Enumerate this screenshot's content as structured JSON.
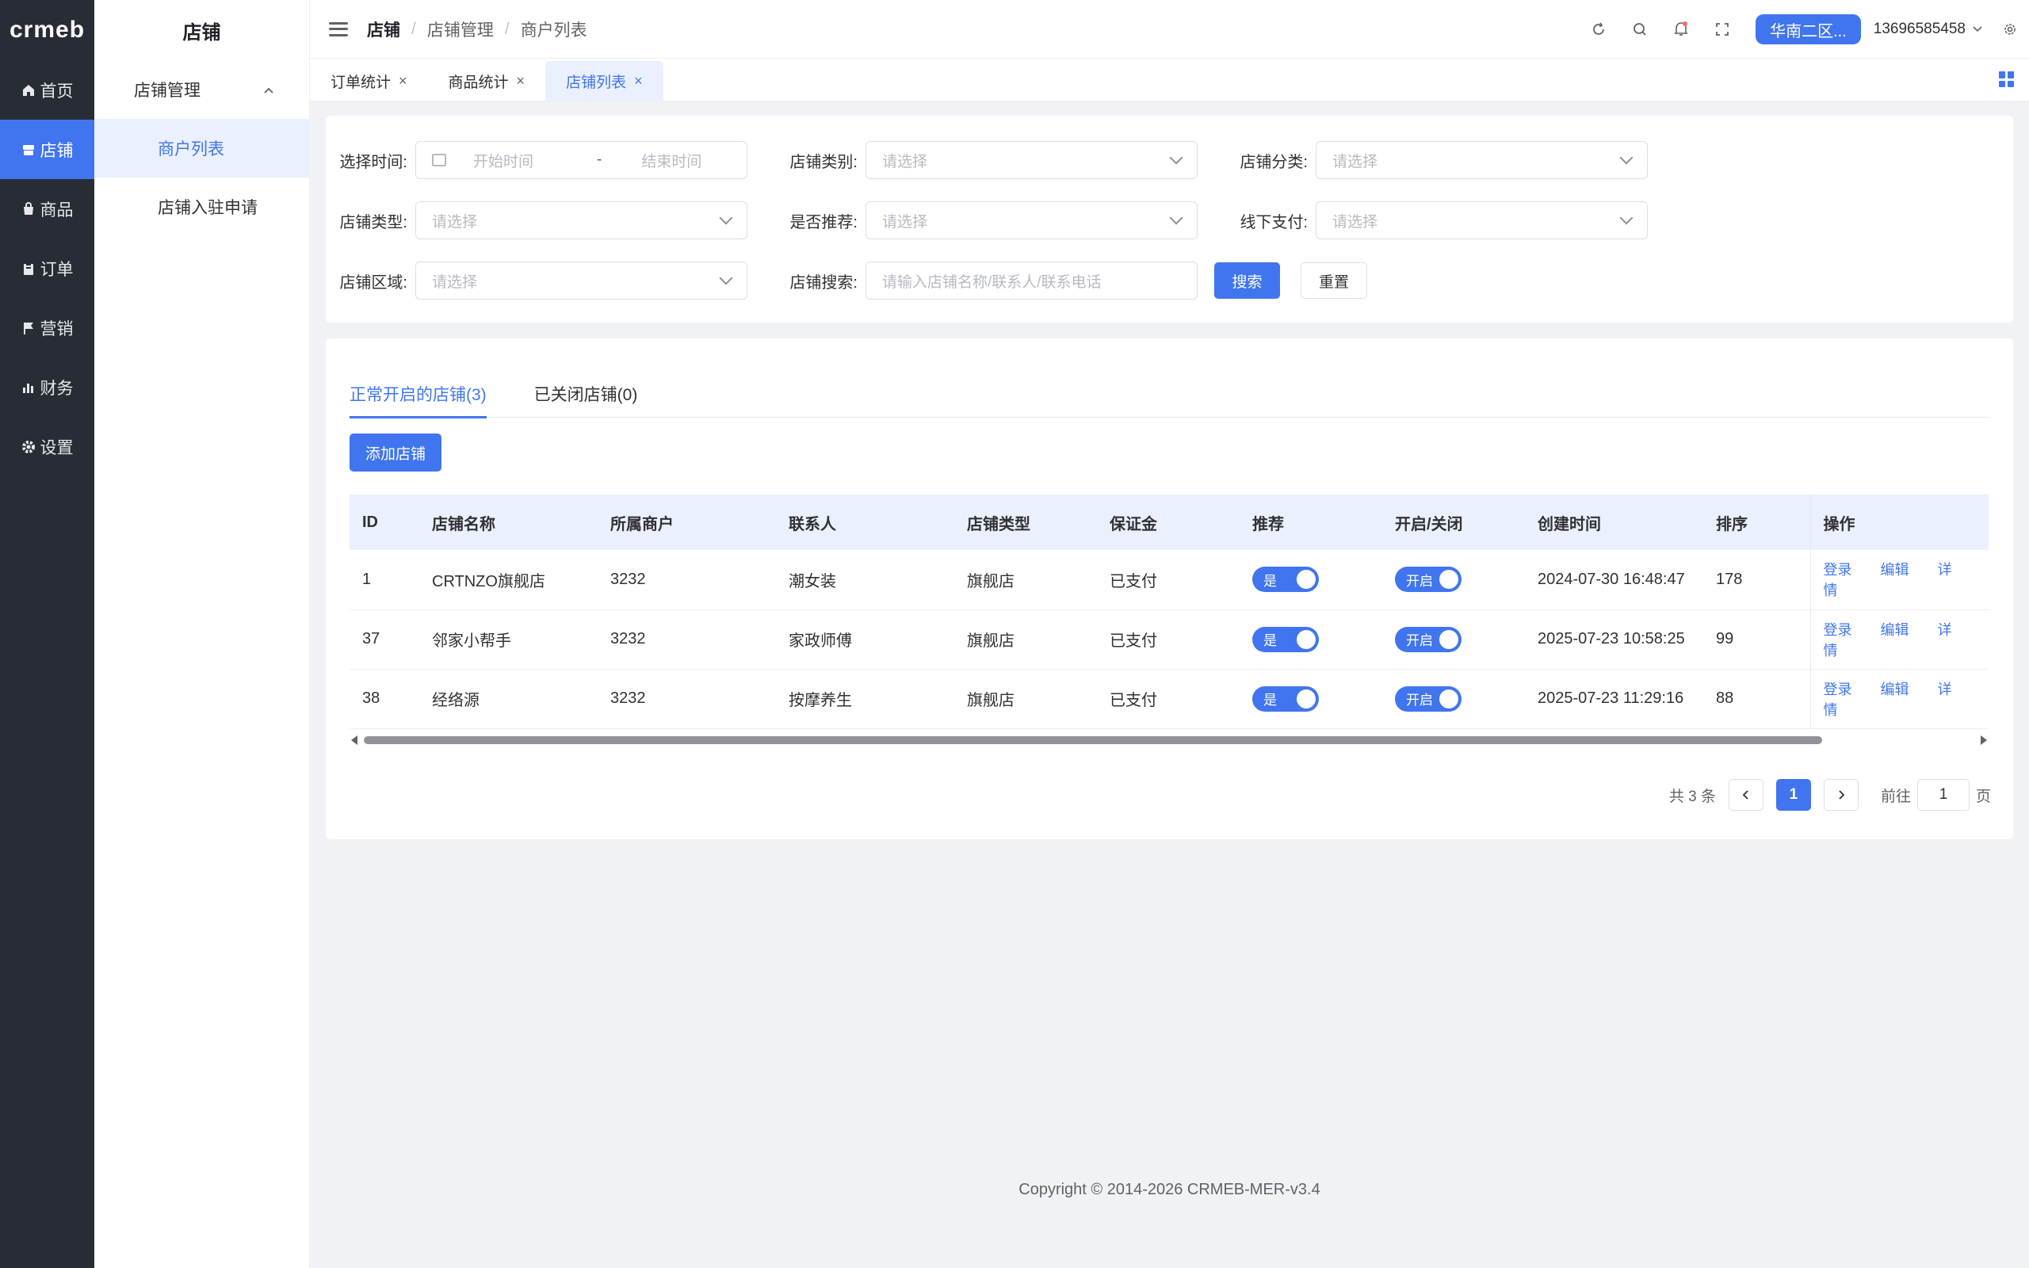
{
  "logo": "crmeb",
  "nav": [
    {
      "label": "首页",
      "icon": "home-icon"
    },
    {
      "label": "店铺",
      "icon": "store-icon",
      "active": true
    },
    {
      "label": "商品",
      "icon": "bag-icon"
    },
    {
      "label": "订单",
      "icon": "clipboard-icon"
    },
    {
      "label": "营销",
      "icon": "flag-icon"
    },
    {
      "label": "财务",
      "icon": "bar-chart-icon"
    },
    {
      "label": "设置",
      "icon": "gear-icon"
    }
  ],
  "submenu": {
    "title": "店铺",
    "group": "店铺管理",
    "items": [
      "商户列表",
      "店铺入驻申请"
    ]
  },
  "breadcrumb": [
    "店铺",
    "店铺管理",
    "商户列表"
  ],
  "header": {
    "region": "华南二区...",
    "account": "13696585458"
  },
  "tabs": [
    "订单统计",
    "商品统计",
    "店铺列表"
  ],
  "filters": {
    "time_label": "选择时间:",
    "start_placeholder": "开始时间",
    "end_placeholder": "结束时间",
    "dash": "-",
    "category_label": "店铺类别:",
    "classify_label": "店铺分类:",
    "type_label": "店铺类型:",
    "recommend_label": "是否推荐:",
    "offline_label": "线下支付:",
    "region_label": "店铺区域:",
    "search_label": "店铺搜索:",
    "select_placeholder": "请选择",
    "search_placeholder": "请输入店铺名称/联系人/联系电话",
    "search_btn": "搜索",
    "reset_btn": "重置"
  },
  "status_tabs": [
    "正常开启的店铺(3)",
    "已关闭店铺(0)"
  ],
  "add_btn": "添加店铺",
  "table": {
    "headers": [
      "ID",
      "店铺名称",
      "所属商户",
      "联系人",
      "店铺类型",
      "保证金",
      "推荐",
      "开启/关闭",
      "创建时间",
      "排序",
      "操作"
    ],
    "rows": [
      {
        "id": "1",
        "name": "CRTNZO旗舰店",
        "merchant": "3232",
        "contact": "潮女装",
        "type": "旗舰店",
        "deposit": "已支付",
        "recommend": "是",
        "open": "开启",
        "created": "2024-07-30 16:48:47",
        "sort": "178"
      },
      {
        "id": "37",
        "name": "邻家小帮手",
        "merchant": "3232",
        "contact": "家政师傅",
        "type": "旗舰店",
        "deposit": "已支付",
        "recommend": "是",
        "open": "开启",
        "created": "2025-07-23 10:58:25",
        "sort": "99"
      },
      {
        "id": "38",
        "name": "经络源",
        "merchant": "3232",
        "contact": "按摩养生",
        "type": "旗舰店",
        "deposit": "已支付",
        "recommend": "是",
        "open": "开启",
        "created": "2025-07-23 11:29:16",
        "sort": "88"
      }
    ],
    "ops": [
      "登录",
      "编辑",
      "详情"
    ]
  },
  "pager": {
    "total": "共 3 条",
    "current": "1",
    "goto_prefix": "前往",
    "goto_value": "1",
    "goto_suffix": "页"
  },
  "footer": "Copyright © 2014-2026 CRMEB-MER-v3.4",
  "colors": {
    "primary": "#4075ef",
    "nav_bg": "#282c34"
  }
}
